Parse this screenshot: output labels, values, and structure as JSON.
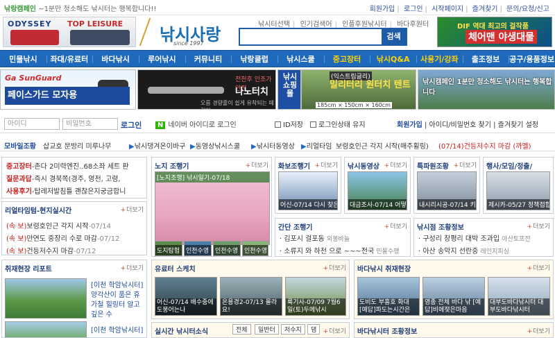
{
  "topbar": {
    "campaign_prefix": "낚랑캠페인",
    "campaign_text": "~1분만 청소해도 낚시터는 행복합니다!!",
    "links": [
      "회원가입",
      "로그인",
      "시작페이지",
      "즐겨찾기",
      "문의/요청/신고"
    ]
  },
  "header": {
    "ad_left_brand1": "ODYSSEY",
    "ad_left_brand2": "TOP LEISURE",
    "logo_text": "낚시사랑",
    "logo_since": "since 1997",
    "quick_links": [
      "낚시터선택",
      "인기검색어",
      "인플후원낚시터",
      "바다후원터"
    ],
    "search_placeholder": "",
    "search_button": "검색",
    "ad_right_line1": "DIF 역대 최고의 걸작품",
    "ad_right_line2": "체어맨 야생대물"
  },
  "nav": {
    "items": [
      {
        "label": "민물낚시",
        "hl": false
      },
      {
        "label": "좌대/유료터",
        "hl": false
      },
      {
        "label": "바다낚시",
        "hl": false
      },
      {
        "label": "루어낚시",
        "hl": false
      },
      {
        "label": "커뮤니티",
        "hl": false
      },
      {
        "label": "낚랑클럽",
        "hl": false
      },
      {
        "label": "낚시스쿨",
        "hl": false
      },
      {
        "label": "중고장터",
        "hl": true
      },
      {
        "label": "낚시Q&A",
        "hl": true
      },
      {
        "label": "사용기/강좌",
        "hl": true
      },
      {
        "label": "출조정보",
        "hl": false
      },
      {
        "label": "공구/용품정보",
        "hl": false
      }
    ]
  },
  "banners": {
    "b1_brand": "Ga SunGuard",
    "b1_cap": "페이스가드 모자용",
    "b2_line1": "전천후 인조가 안전",
    "b2_line2": "나노터치",
    "b2_line3": "오름 경량줄이 쉽게 유착되는 떼림형",
    "b3_text": "낚시쇼핑몰",
    "b4_line1": "(익스트림글리)",
    "b4_line2": "밀리터리 원터치 텐트",
    "b4_size": "185cm × 150cm × 160cm",
    "b5_text": "낚시캠페인 1분만 청소해도 낚시터는 행복합니다"
  },
  "login": {
    "id_placeholder": "아이디",
    "pw_placeholder": "비밀번호",
    "button": "로그인",
    "naver_badge": "N",
    "naver_text": "네이버 아이디로 로그인",
    "save_id": "ID저장",
    "keep_login": "로그인상태 유지",
    "links": [
      "회원가입",
      "아이디/비밀번호 찾기",
      "즐겨찾기 설정"
    ]
  },
  "ticker": {
    "label": "모바일조황",
    "items": [
      {
        "text": "샵교호 문방리 미루나무",
        "marker": false
      },
      {
        "text": "낚시댕겨온이바구",
        "marker": true
      },
      {
        "text": "동영상낚시스쿨",
        "marker": true
      },
      {
        "text": "낚시터동영상",
        "marker": true
      },
      {
        "text": "리얼타임",
        "marker": true
      },
      {
        "text": "보령호인근 각지 시작(매주휠링)",
        "marker": false
      },
      {
        "text": "(07/14)건등저수지 마감 (까멜)",
        "marker": false
      }
    ]
  },
  "left_panel": {
    "lines": [
      {
        "tag": "중고장터",
        "text": "-존다 2미력엔진..68소좌 세트 판"
      },
      {
        "tag": "질문과답",
        "text": "-즉시 경북쪽(경주, 영천, 고령,"
      },
      {
        "tag": "사용후기",
        "text": "-탑레저발침틀 괜찮은지궁금합니"
      }
    ]
  },
  "realtime": {
    "title": "리얼타임텀-현지실시간",
    "more": "더보기",
    "items": [
      {
        "tag": "(속 보)",
        "text": "보령호인근 각지 시작",
        "date": "-07/14"
      },
      {
        "tag": "(속 보)",
        "text": "만연도 중장리 수로 마감",
        "date": "-07/12"
      },
      {
        "tag": "(속 보)",
        "text": "건등저수지 마감",
        "date": "-07/12"
      }
    ]
  },
  "report": {
    "title": "취재현장 리포트",
    "more": "더보기",
    "caption": "[이천 학암낚시터] 양각산이 품은 휴가철 힐링터 알고 깊은 수",
    "caption2": "[이천 학암낚시터] 양각산이 품은 휴가철 힐링터 알고 깊은 수",
    "caption3": "[이천 학암낚시터]"
  },
  "nojo": {
    "title": "노지 조행기",
    "more": "더보기",
    "main_caption": "[노지조행] 낚시일기-07/18",
    "strip": [
      "도지탐험",
      "인천수영",
      "인천수영",
      "인천수영"
    ]
  },
  "photo": {
    "title": "화보조행기",
    "more": "더보기",
    "caption": "어신-07/14 다시 찾은 만금호 우"
  },
  "video": {
    "title": "낚시동영상",
    "more": "더보기",
    "caption": "대금조사-07/14 어떻게할"
  },
  "special": {
    "title": "특파원조황",
    "more": "더보기",
    "caption": "내시리시공-07/14 키다리낚시터 허리급"
  },
  "event": {
    "title": "행사/모임/정출/",
    "caption": "제시카-05/27 정책접합식(예양수"
  },
  "ganjan": {
    "title": "간단 조행기",
    "more": "더보기",
    "items": [
      {
        "text": "김포시 걸포동",
        "date": "외봉바늘"
      },
      {
        "text": "소류지 와 하천 으로 ~~~전국",
        "date": "민물수행"
      }
    ]
  },
  "shop": {
    "title": "낚시점 조황정보",
    "more": "더보기",
    "items": [
      {
        "text": "구성리 창평리 대박 조과입",
        "date": "아산토프전"
      },
      {
        "text": "아산 송악지 선란중",
        "date": "레인지피싱"
      }
    ]
  },
  "yuryo": {
    "title": "유료터 스케치",
    "more": "더보기",
    "items": [
      {
        "caption": "어신-07/14 배수중에도붕어는나"
      },
      {
        "caption": "온용경2-07/13 몰라요!"
      },
      {
        "caption": "룩기사-07/09 7월6일(토)두메낚시"
      }
    ]
  },
  "sea": {
    "title": "바다낚시 취재현장",
    "more": "더보기",
    "items": [
      {
        "caption": "도비도 부흥호 화대 [예답]파도는시간은"
      },
      {
        "caption": "영종 전체 바다 낚 [예답]비에젖은마음"
      },
      {
        "caption": "대부도바다낚시터 대부도바다낚시터"
      }
    ]
  },
  "realfish": {
    "title": "실시간 낚시터소식",
    "tabs": [
      "전체",
      "일반터",
      "저수지",
      "댐"
    ],
    "more": "더보기"
  },
  "seafish": {
    "title": "바다낚시터 조황정보",
    "more": "더보기"
  },
  "colors": {
    "nav": "#1f69bd",
    "accent": "#c81d1d",
    "link": "#1d4a9c"
  }
}
